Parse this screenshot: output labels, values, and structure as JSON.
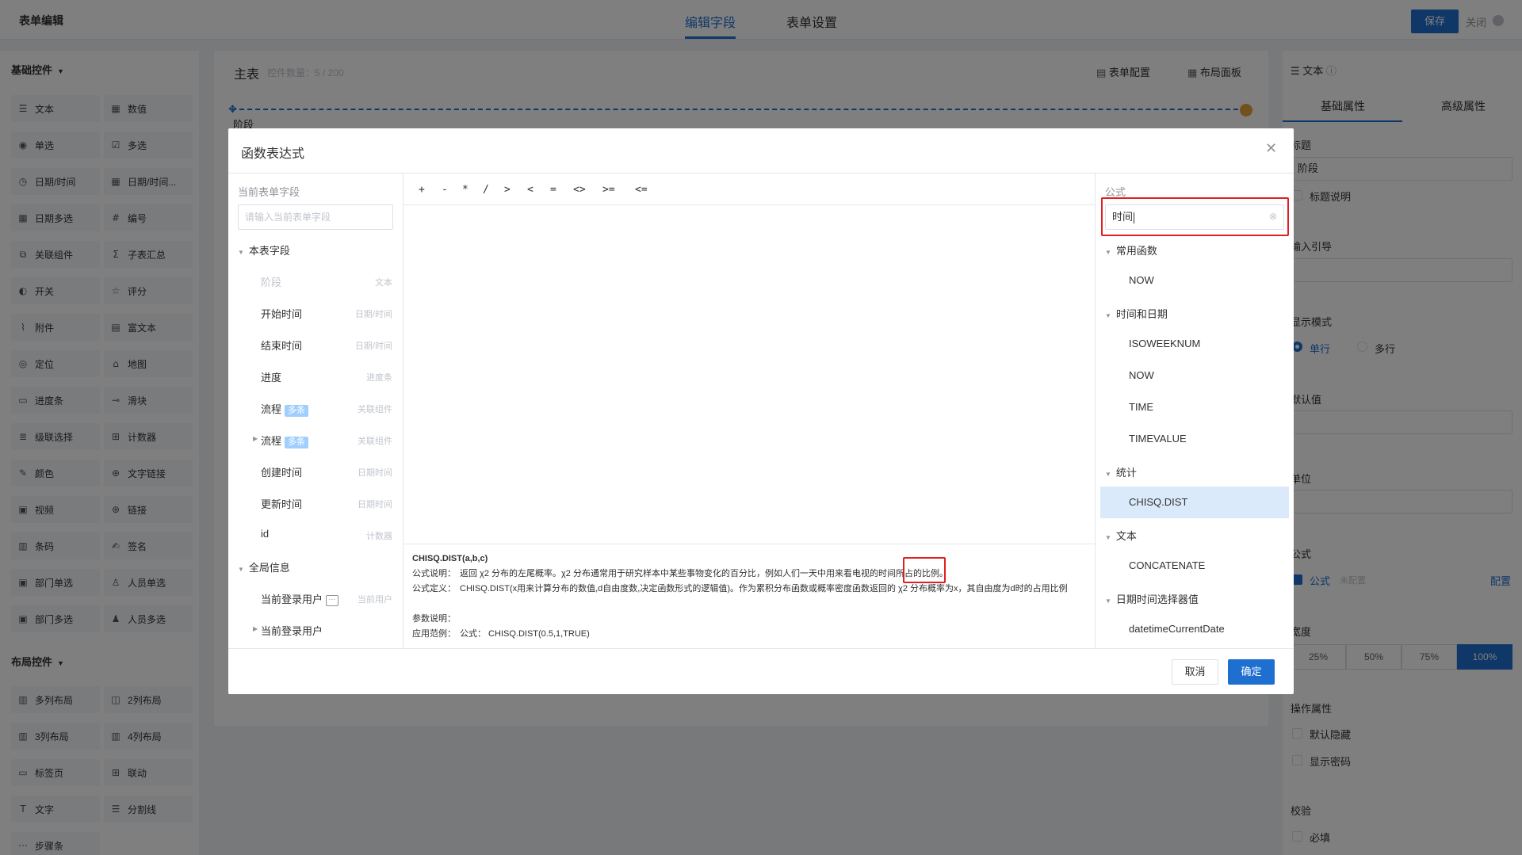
{
  "topbar": {
    "app_title": "表单编辑",
    "tabs": [
      {
        "label": "编辑字段"
      },
      {
        "label": "表单设置"
      }
    ],
    "save_label": "保存",
    "close_label": "关闭"
  },
  "left_panel": {
    "basic_title": "基础控件",
    "basic_items": [
      {
        "label": "文本",
        "icon": "text-icon"
      },
      {
        "label": "数值",
        "icon": "number-icon"
      },
      {
        "label": "单选",
        "icon": "radio-icon"
      },
      {
        "label": "多选",
        "icon": "checkbox-icon"
      },
      {
        "label": "日期/时间",
        "icon": "clock-icon"
      },
      {
        "label": "日期/时间...",
        "icon": "calendar-icon"
      },
      {
        "label": "日期多选",
        "icon": "calendar-multi-icon"
      },
      {
        "label": "编号",
        "icon": "serial-icon"
      },
      {
        "label": "关联组件",
        "icon": "link-component-icon"
      },
      {
        "label": "子表汇总",
        "icon": "sigma-icon"
      },
      {
        "label": "开关",
        "icon": "toggle-icon"
      },
      {
        "label": "评分",
        "icon": "star-icon"
      },
      {
        "label": "附件",
        "icon": "paperclip-icon"
      },
      {
        "label": "富文本",
        "icon": "richtext-icon"
      },
      {
        "label": "定位",
        "icon": "location-icon"
      },
      {
        "label": "地图",
        "icon": "map-icon"
      },
      {
        "label": "进度条",
        "icon": "progress-icon"
      },
      {
        "label": "滑块",
        "icon": "slider-icon"
      },
      {
        "label": "级联选择",
        "icon": "cascade-icon"
      },
      {
        "label": "计数器",
        "icon": "counter-icon"
      },
      {
        "label": "颜色",
        "icon": "color-picker-icon"
      },
      {
        "label": "文字链接",
        "icon": "globe-icon"
      },
      {
        "label": "视频",
        "icon": "video-icon"
      },
      {
        "label": "链接",
        "icon": "globe-link-icon"
      },
      {
        "label": "条码",
        "icon": "barcode-icon"
      },
      {
        "label": "签名",
        "icon": "signature-icon"
      },
      {
        "label": "部门单选",
        "icon": "department-icon"
      },
      {
        "label": "人员单选",
        "icon": "user-icon"
      },
      {
        "label": "部门多选",
        "icon": "department-multi-icon"
      },
      {
        "label": "人员多选",
        "icon": "users-icon"
      }
    ],
    "layout_title": "布局控件",
    "layout_items": [
      {
        "label": "多列布局",
        "icon": "columns-icon"
      },
      {
        "label": "2列布局",
        "icon": "two-columns-icon"
      },
      {
        "label": "3列布局",
        "icon": "three-columns-icon"
      },
      {
        "label": "4列布局",
        "icon": "four-columns-icon"
      },
      {
        "label": "标签页",
        "icon": "tabs-icon"
      },
      {
        "label": "联动",
        "icon": "linkage-icon"
      },
      {
        "label": "文字",
        "icon": "text-t-icon"
      },
      {
        "label": "分割线",
        "icon": "divider-icon"
      },
      {
        "label": "步骤条",
        "icon": "steps-icon"
      }
    ]
  },
  "canvas": {
    "title": "主表",
    "count": "控件数量：5 / 200",
    "form_config": "表单配置",
    "layout_panel": "布局面板",
    "stage_label": "阶段"
  },
  "right_panel": {
    "header": "文本",
    "tabs": [
      {
        "label": "基础属性"
      },
      {
        "label": "高级属性"
      }
    ],
    "title_label": "标题",
    "title_value": "阶段",
    "title_desc": "标题说明",
    "input_guide": "输入引导",
    "display_mode": "显示模式",
    "single_line": "单行",
    "multi_line": "多行",
    "default_value": "默认值",
    "unit": "单位",
    "formula": "公式",
    "formula_check": "公式",
    "formula_state": "未配置",
    "configure": "配置",
    "width": "宽度",
    "width_options": [
      "25%",
      "50%",
      "75%",
      "100%"
    ],
    "operations": "操作属性",
    "default_hidden": "默认隐藏",
    "show_password": "显示密码",
    "validation": "校验",
    "required": "必填"
  },
  "modal": {
    "title": "函数表达式",
    "fields_label": "当前表单字段",
    "fields_placeholder": "请输入当前表单字段",
    "groups": [
      {
        "label": "本表字段",
        "items": [
          {
            "label": "阶段",
            "type": "文本"
          },
          {
            "label": "开始时间",
            "type": "日期/时间"
          },
          {
            "label": "结束时间",
            "type": "日期/时间"
          },
          {
            "label": "进度",
            "type": "进度条"
          },
          {
            "label": "流程",
            "badge": "多条",
            "type": "关联组件"
          },
          {
            "label": "流程",
            "badge": "多条",
            "type": "关联组件"
          },
          {
            "label": "创建时间",
            "type": "日期时间"
          },
          {
            "label": "更新时间",
            "type": "日期时间"
          },
          {
            "label": "id",
            "type": "计数器"
          }
        ]
      },
      {
        "label": "全局信息",
        "items": [
          {
            "label": "当前登录用户",
            "type": "当前用户"
          },
          {
            "label": "当前登录用户",
            "type": ""
          }
        ]
      }
    ],
    "operators": [
      "+",
      "-",
      "*",
      "/",
      ">",
      "<",
      "=",
      "<>",
      ">=",
      "<="
    ],
    "desc_title": "CHISQ.DIST(a,b,c)",
    "desc_lines": [
      {
        "label": "公式说明：",
        "text": "返回 χ2 分布的左尾概率。χ2 分布通常用于研究样本中某些事物变化的百分比，例如人们一天中用来看电视的时间所占的比例。"
      },
      {
        "label": "公式定义：",
        "text": "CHISQ.DIST(x用来计算分布的数值,d自由度数,决定函数形式的逻辑值)。作为累积分布函数或概率密度函数返回的 χ2 分布概率为x，其自由度为d时的占用比例"
      },
      {
        "label": "参数说明：",
        "text": ""
      },
      {
        "label": "应用范例：",
        "text": "公式：  CHISQ.DIST(0.5,1,TRUE)"
      }
    ],
    "formula_label": "公式",
    "search_value": "时间",
    "fn_groups": [
      {
        "label": "常用函数",
        "items": [
          "NOW"
        ]
      },
      {
        "label": "时间和日期",
        "items": [
          "ISOWEEKNUM",
          "NOW",
          "TIME",
          "TIMEVALUE"
        ]
      },
      {
        "label": "统计",
        "items": [
          "CHISQ.DIST"
        ]
      },
      {
        "label": "文本",
        "items": [
          "CONCATENATE"
        ]
      },
      {
        "label": "日期时间选择器值",
        "items": [
          "datetimeCurrentDate"
        ]
      }
    ],
    "cancel_label": "取消",
    "ok_label": "确定"
  }
}
